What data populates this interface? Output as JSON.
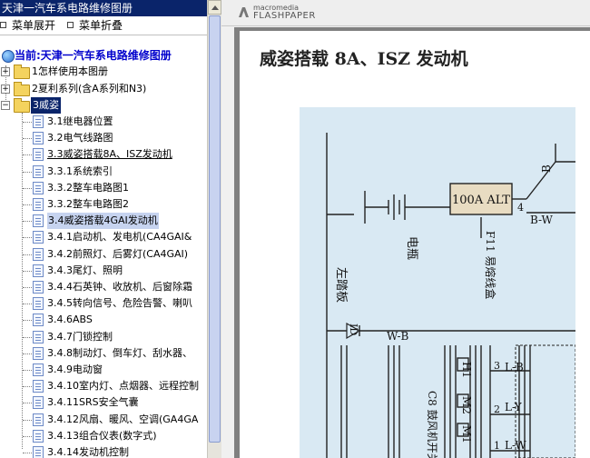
{
  "left_pane": {
    "title": "天津一汽车系电路维修图册",
    "menu": {
      "expand": "菜单展开",
      "collapse": "菜单折叠"
    },
    "tree_root": "当前:天津一汽车系电路维修图册",
    "folders": [
      {
        "label": "1怎样使用本图册",
        "state": "collapsed"
      },
      {
        "label": "2夏利系列(含A系列和N3)",
        "state": "collapsed"
      },
      {
        "label": "3威姿",
        "state": "expanded-selected"
      }
    ],
    "items": [
      {
        "label": "3.1继电器位置"
      },
      {
        "label": "3.2电气线路图"
      },
      {
        "label": "3.3威姿搭载8A、ISZ发动机",
        "style": "underlined"
      },
      {
        "label": "3.3.1系统索引"
      },
      {
        "label": "3.3.2整车电路图1"
      },
      {
        "label": "3.3.2整车电路图2"
      },
      {
        "label": "3.4威姿搭载4GAI发动机",
        "style": "highlighted"
      },
      {
        "label": "3.4.1启动机、发电机(CA4GAI&"
      },
      {
        "label": "3.4.2前照灯、后雾灯(CA4GAI)"
      },
      {
        "label": "3.4.3尾灯、照明"
      },
      {
        "label": "3.4.4石英钟、收放机、后窗除霜"
      },
      {
        "label": "3.4.5转向信号、危险告警、喇叭"
      },
      {
        "label": "3.4.6ABS"
      },
      {
        "label": "3.4.7门锁控制"
      },
      {
        "label": "3.4.8制动灯、倒车灯、刮水器、"
      },
      {
        "label": "3.4.9电动窗"
      },
      {
        "label": "3.4.10室内灯、点烟器、远程控制"
      },
      {
        "label": "3.4.11SRS安全气囊"
      },
      {
        "label": "3.4.12风扇、暖风、空调(GA4GA"
      },
      {
        "label": "3.4.13组合仪表(数字式)"
      },
      {
        "label": "3.4.14发动机控制"
      }
    ]
  },
  "viewer": {
    "brand_top": "macromedia",
    "brand_bottom": "FLASHPAPER",
    "page_title": "威姿搭载 8A、ISZ 发动机",
    "schematic_labels": {
      "alt": "100A ALT",
      "fuse": "F11 易熔线盒",
      "battery": "电瓶",
      "kick": "左踏板",
      "id": "ID",
      "wb": "W-B",
      "bw": "B-W",
      "b": "B",
      "four": "4",
      "h1": "H1",
      "m2": "M2",
      "m1": "M1",
      "c8": "C8 鼓风机开关",
      "lb": "L-B",
      "ly": "L-Y",
      "lw": "L-W",
      "n3": "3",
      "n2": "2",
      "n1": "1"
    }
  },
  "colors": {
    "title_bar": "#0a246a",
    "selection": "#0a246a",
    "highlight": "#c6d3ef",
    "schematic_bg": "#d9e9f3",
    "alt_box": "#e8dcc2"
  }
}
